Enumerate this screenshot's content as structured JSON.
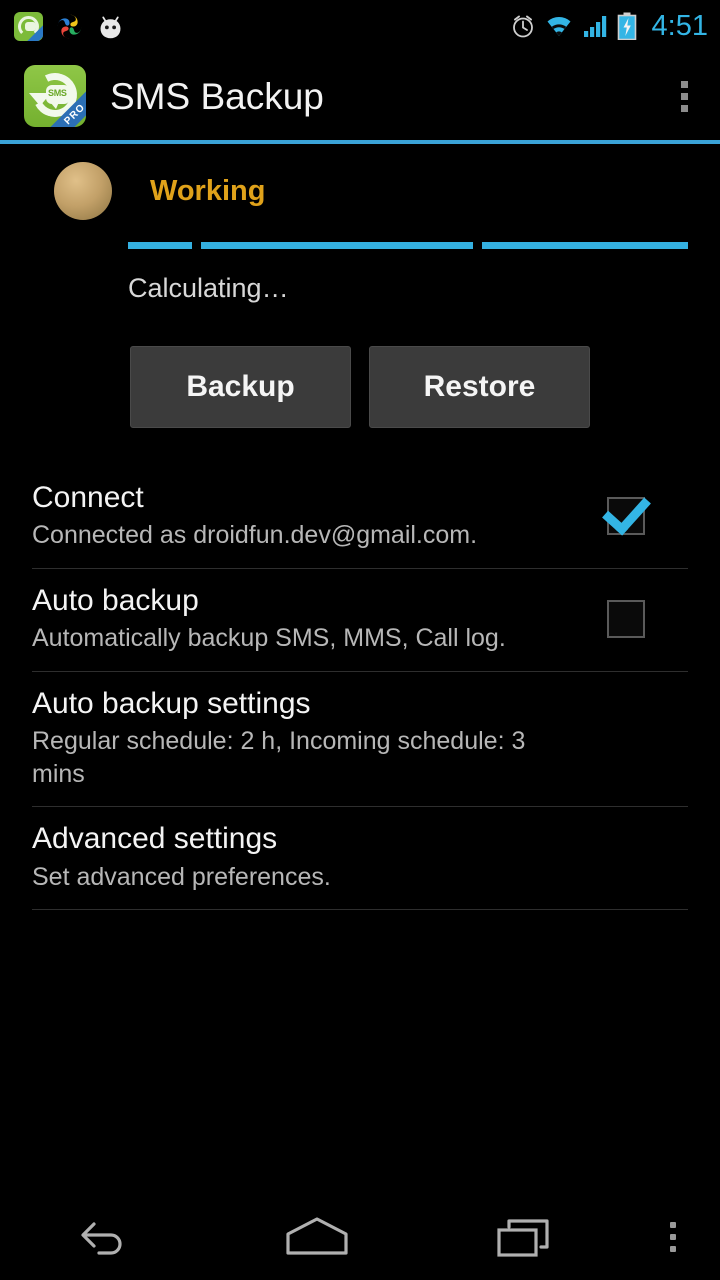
{
  "status_bar": {
    "time": "4:51",
    "time_color": "#33b5e5",
    "notification_icons": [
      "sms-backup-app-icon",
      "pinwheel-sync-icon",
      "cyanogenmod-android-icon"
    ],
    "system_icons": [
      "alarm-clock-icon",
      "wifi-icon",
      "cell-signal-icon",
      "battery-charging-icon"
    ]
  },
  "action_bar": {
    "title": "SMS Backup",
    "app_icon_badge": "PRO",
    "app_icon_label": "SMS",
    "overflow_icon": "overflow-menu-icon",
    "accent_color": "#3aa3d8"
  },
  "status_panel": {
    "state_label": "Working",
    "state_color": "#e0a21a",
    "progress_label": "Calculating…",
    "progress_indeterminate": true,
    "progress_color": "#34b0e0",
    "progress_segments": [
      {
        "width_pct": 11.5,
        "gap_pct": 1.6
      },
      {
        "width_pct": 48.5,
        "gap_pct": 1.6
      },
      {
        "width_pct": 36.8,
        "gap_pct": 0
      }
    ]
  },
  "buttons": {
    "backup_label": "Backup",
    "restore_label": "Restore"
  },
  "preferences": [
    {
      "key": "connect",
      "title": "Connect",
      "summary": "Connected as droidfun.dev@gmail.com.",
      "widget": "checkbox",
      "checked": true
    },
    {
      "key": "auto-backup",
      "title": "Auto backup",
      "summary": "Automatically backup SMS, MMS, Call log.",
      "widget": "checkbox",
      "checked": false
    },
    {
      "key": "auto-backup-settings",
      "title": "Auto backup settings",
      "summary": "Regular schedule: 2 h, Incoming schedule: 3 mins",
      "widget": "none",
      "checked": false
    },
    {
      "key": "advanced-settings",
      "title": "Advanced settings",
      "summary": "Set advanced preferences.",
      "widget": "none",
      "checked": false
    }
  ],
  "nav_bar": {
    "back_icon": "back-arrow-icon",
    "home_icon": "home-icon",
    "recents_icon": "recent-apps-icon",
    "overflow_icon": "overflow-menu-icon"
  }
}
